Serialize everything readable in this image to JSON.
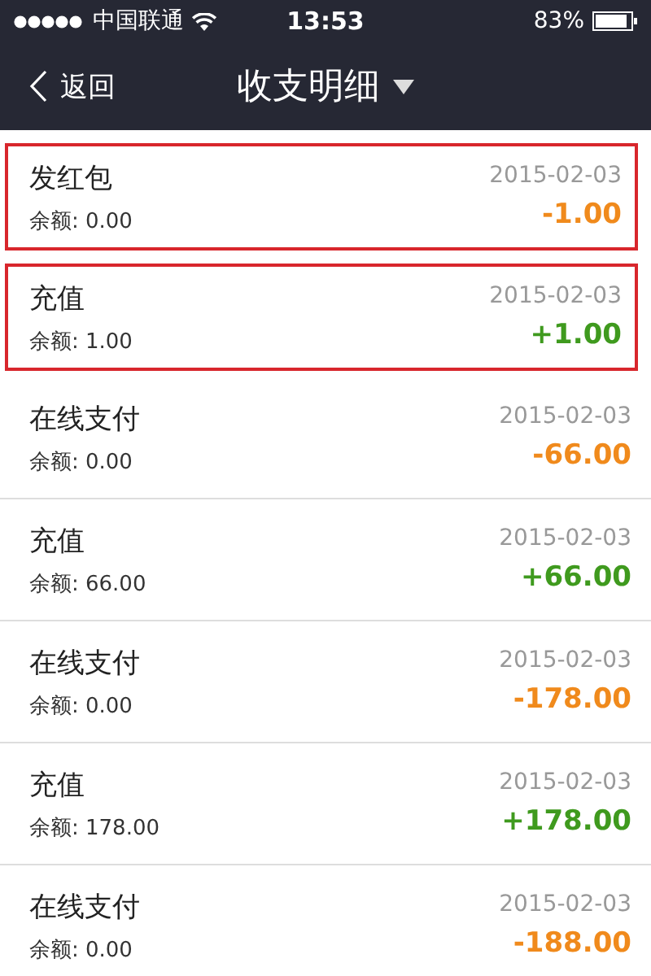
{
  "status_bar": {
    "carrier": "中国联通",
    "time": "13:53",
    "battery": "83%"
  },
  "nav": {
    "back": "返回",
    "title": "收支明细"
  },
  "records": [
    {
      "name": "发红包",
      "balance": "余额: 0.00",
      "date": "2015-02-03",
      "amount": "-1.00",
      "kind": "expense",
      "highlighted": true
    },
    {
      "name": "充值",
      "balance": "余额: 1.00",
      "date": "2015-02-03",
      "amount": "+1.00",
      "kind": "income",
      "highlighted": true
    },
    {
      "name": "在线支付",
      "balance": "余额: 0.00",
      "date": "2015-02-03",
      "amount": "-66.00",
      "kind": "expense",
      "highlighted": false
    },
    {
      "name": "充值",
      "balance": "余额: 66.00",
      "date": "2015-02-03",
      "amount": "+66.00",
      "kind": "income",
      "highlighted": false
    },
    {
      "name": "在线支付",
      "balance": "余额: 0.00",
      "date": "2015-02-03",
      "amount": "-178.00",
      "kind": "expense",
      "highlighted": false
    },
    {
      "name": "充值",
      "balance": "余额: 178.00",
      "date": "2015-02-03",
      "amount": "+178.00",
      "kind": "income",
      "highlighted": false
    },
    {
      "name": "在线支付",
      "balance": "余额: 0.00",
      "date": "2015-02-03",
      "amount": "-188.00",
      "kind": "expense",
      "highlighted": false
    }
  ]
}
